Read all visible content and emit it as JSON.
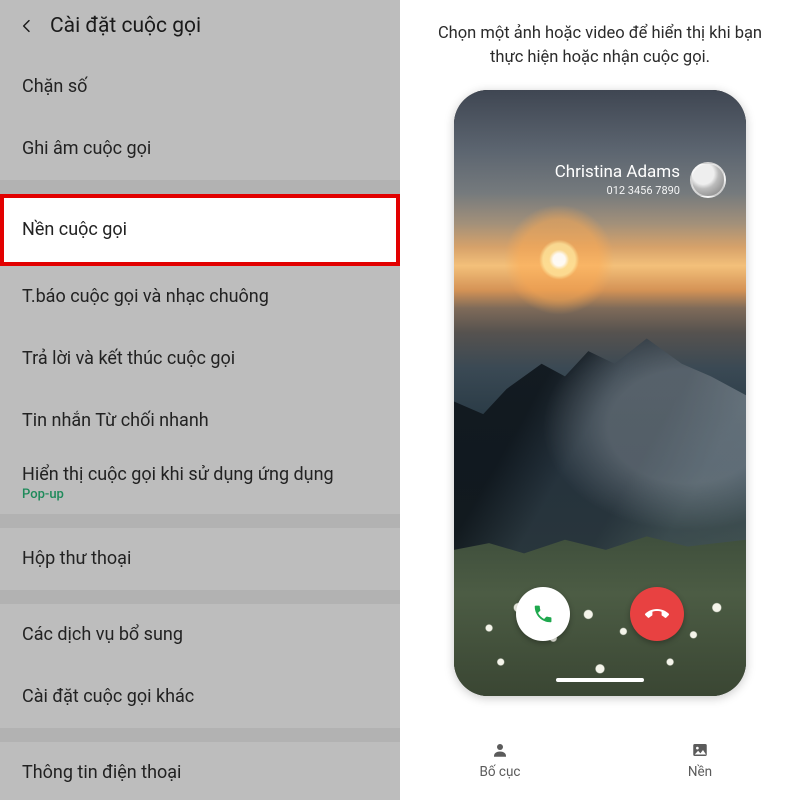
{
  "left": {
    "title": "Cài đặt cuộc gọi",
    "items": {
      "block": "Chặn số",
      "record": "Ghi âm cuộc gọi",
      "background": "Nền cuộc gọi",
      "alerts": "T.báo cuộc gọi và nhạc chuông",
      "answer": "Trả lời và kết thúc cuộc gọi",
      "quickdec": "Tin nhắn Từ chối nhanh",
      "showcall": "Hiển thị cuộc gọi khi sử dụng ứng dụng",
      "showcall_sub": "Pop-up",
      "voicemail": "Hộp thư thoại",
      "supp": "Các dịch vụ bổ sung",
      "other": "Cài đặt cuộc gọi khác",
      "info": "Thông tin điện thoại"
    }
  },
  "right": {
    "description": "Chọn một ảnh hoặc video để hiển thị khi bạn thực hiện hoặc nhận cuộc gọi.",
    "caller_name": "Christina Adams",
    "caller_number": "012 3456 7890",
    "tab_layout": "Bố cục",
    "tab_background": "Nền"
  },
  "colors": {
    "highlight_border": "#e20000",
    "accept": "#1fa84e",
    "reject": "#e84141",
    "sub": "#1e8a5a"
  }
}
